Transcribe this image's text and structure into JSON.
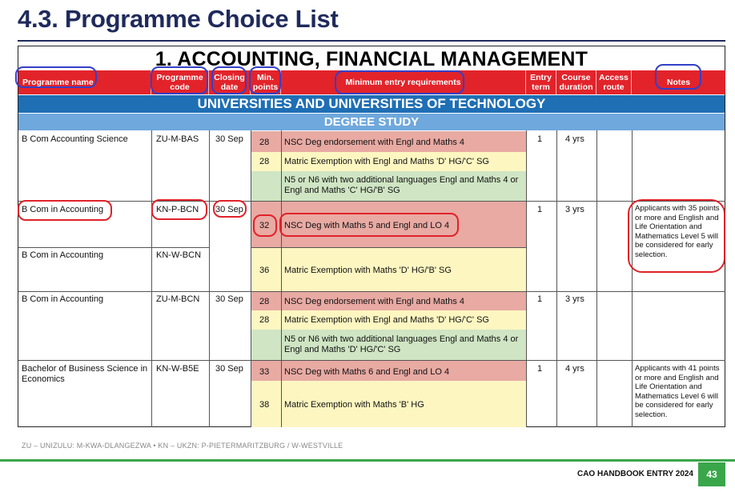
{
  "page": {
    "title": "4.3. Programme Choice List",
    "section_title": "1. ACCOUNTING, FINANCIAL MANAGEMENT",
    "band_universities": "UNIVERSITIES AND UNIVERSITIES OF TECHNOLOGY",
    "band_degree": "DEGREE STUDY"
  },
  "headers": {
    "programme_name": "Programme name",
    "programme_code_1": "Programme",
    "programme_code_2": "code",
    "closing_date_1": "Closing",
    "closing_date_2": "date",
    "min_points_1": "Min.",
    "min_points_2": "points",
    "requirements": "Minimum entry requirements",
    "entry_term_1": "Entry",
    "entry_term_2": "term",
    "duration_1": "Course",
    "duration_2": "duration",
    "access_1": "Access",
    "access_2": "route",
    "notes": "Notes"
  },
  "rows": [
    {
      "name": "B Com Accounting Science",
      "code": "ZU-M-BAS",
      "closing": "30 Sep",
      "term": "1",
      "duration": "4 yrs",
      "notes": "",
      "req": [
        {
          "points": "28",
          "text": "NSC Deg endorsement with Engl and Maths 4"
        },
        {
          "points": "28",
          "text": "Matric Exemption with Engl and Maths 'D' HG/'C' SG"
        },
        {
          "points": "",
          "text": "N5 or N6 with two additional languages Engl and Maths 4 or Engl and Maths 'C' HG/'B' SG"
        }
      ]
    },
    {
      "name": "B Com in Accounting",
      "code": "KN-P-BCN",
      "closing": "30 Sep",
      "term": "1",
      "duration": "3 yrs",
      "notes": "Applicants with 35 points or more and English and Life Orientation and Mathematics Level 5 will be considered for early selection.",
      "req": [
        {
          "points": "32",
          "text": "NSC Deg with Maths 5 and Engl and LO 4"
        }
      ]
    },
    {
      "name": "B Com in Accounting",
      "code": "KN-W-BCN",
      "closing": "",
      "term": "",
      "duration": "",
      "notes": "",
      "req": [
        {
          "points": "36",
          "text": "Matric Exemption with Maths 'D' HG/'B' SG"
        }
      ]
    },
    {
      "name": "B Com in Accounting",
      "code": "ZU-M-BCN",
      "closing": "30 Sep",
      "term": "1",
      "duration": "3 yrs",
      "notes": "",
      "req": [
        {
          "points": "28",
          "text": "NSC Deg endorsement with Engl and Maths 4"
        },
        {
          "points": "28",
          "text": "Matric Exemption with Engl and Maths 'D' HG/'C' SG"
        },
        {
          "points": "",
          "text": "N5 or N6 with two additional languages Engl and Maths 4 or Engl and Maths 'D' HG/'C' SG"
        }
      ]
    },
    {
      "name": "Bachelor of Business Science in Economics",
      "code": "KN-W-B5E",
      "closing": "30 Sep",
      "term": "1",
      "duration": "4 yrs",
      "notes": "Applicants with 41 points or more and English and Life Orientation and Mathematics Level 6 will be considered for early selection.",
      "req": [
        {
          "points": "33",
          "text": "NSC Deg with Maths 6 and Engl and LO 4"
        },
        {
          "points": "38",
          "text": "Matric Exemption with Maths 'B' HG"
        }
      ]
    }
  ],
  "footer": {
    "footnote": "ZU – UNIZULU: M-KWA-DLANGEZWA • KN – UKZN: P-PIETERMARITZBURG / W-WESTVILLE",
    "label": "CAO HANDBOOK ENTRY 2024",
    "page_number": "43"
  },
  "colors": {
    "header_red": "#e2232a",
    "band_blue": "#1f6fb4",
    "band_light_blue": "#6fa8dc",
    "row_pink": "#e8aaa3",
    "row_yellow": "#fdf6c1",
    "row_green": "#cfe5c3",
    "annotation_blue": "#3340c8",
    "annotation_red": "#e0222a",
    "footer_green": "#3aa64a"
  }
}
